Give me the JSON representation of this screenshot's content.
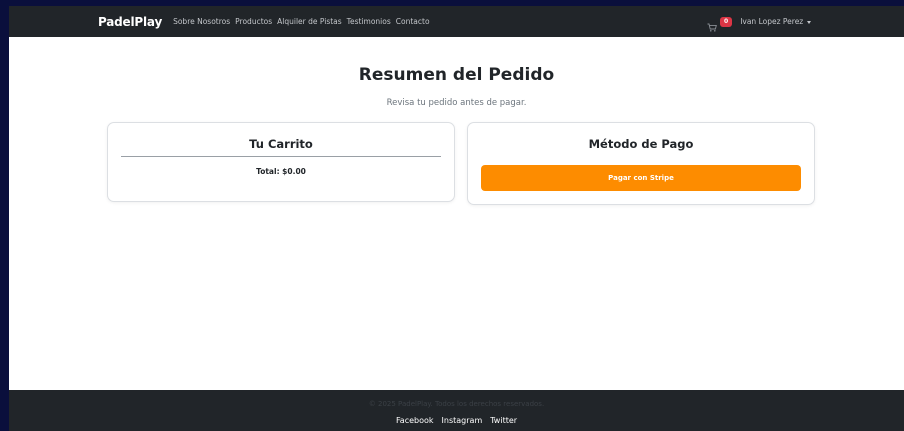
{
  "navbar": {
    "brand": "PadelPlay",
    "links": [
      "Sobre Nosotros",
      "Productos",
      "Alquiler de Pistas",
      "Testimonios",
      "Contacto"
    ],
    "cart_icon": "cart-icon",
    "cart_count": "0",
    "user_name": "Ivan Lopez Perez"
  },
  "main": {
    "title": "Resumen del Pedido",
    "subtitle": "Revisa tu pedido antes de pagar.",
    "cart_card": {
      "title": "Tu Carrito",
      "total": "Total: $0.00"
    },
    "payment_card": {
      "title": "Método de Pago",
      "button_label": "Pagar con Stripe"
    }
  },
  "footer": {
    "copyright": "© 2025 PadelPlay. Todos los derechos reservados.",
    "links": [
      "Facebook",
      "Instagram",
      "Twitter"
    ]
  },
  "colors": {
    "navbar_bg": "#212529",
    "accent": "#fd8c00",
    "badge": "#dc3545",
    "outer_bg": "#0a0f3c"
  }
}
